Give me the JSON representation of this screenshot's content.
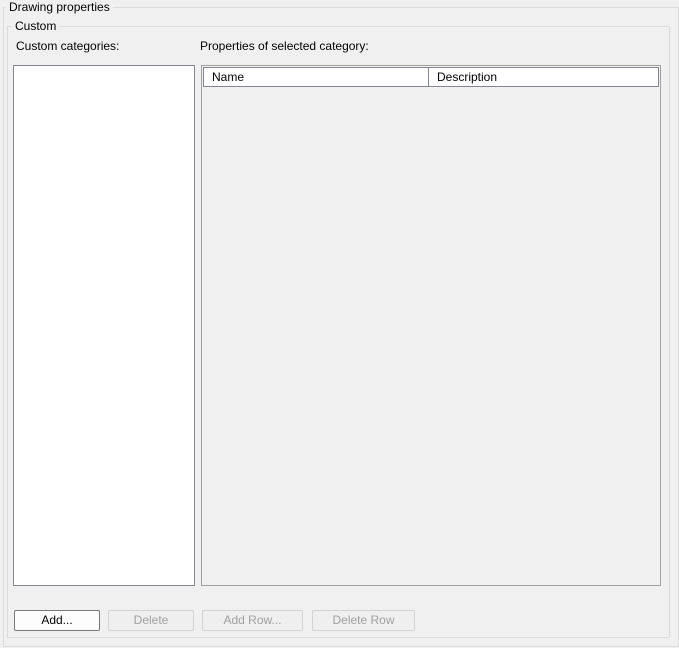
{
  "groups": {
    "outer_title": "Drawing properties",
    "inner_title": "Custom"
  },
  "labels": {
    "custom_categories": "Custom categories:",
    "properties_of_selected": "Properties of selected category:"
  },
  "categories": [],
  "grid": {
    "columns": [
      "Name",
      "Description"
    ],
    "rows": []
  },
  "buttons": {
    "add": "Add...",
    "delete": "Delete",
    "add_row": "Add Row...",
    "delete_row": "Delete Row"
  },
  "colors": {
    "background": "#f0f0f0",
    "list_background": "#ffffff",
    "disabled_text": "#a0a0a0"
  }
}
